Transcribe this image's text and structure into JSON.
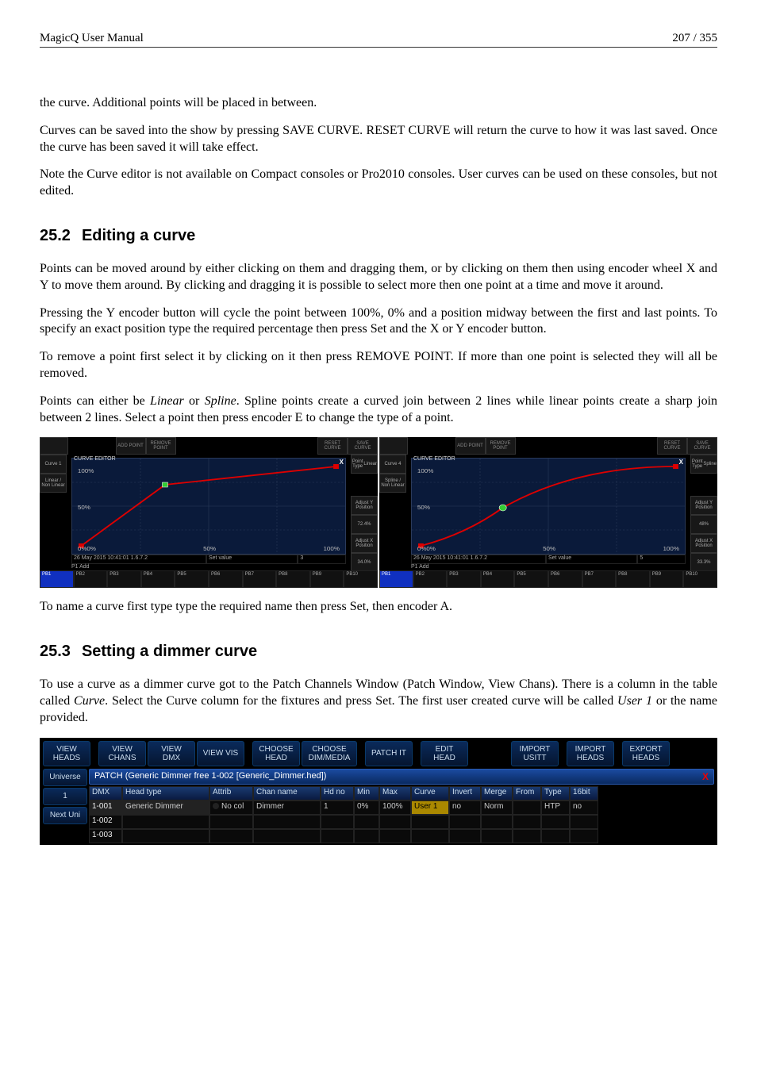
{
  "header": {
    "left": "MagicQ User Manual",
    "right": "207 / 355"
  },
  "intro": {
    "p1": "the curve. Additional points will be placed in between.",
    "p2": "Curves can be saved into the show by pressing SAVE CURVE. RESET CURVE will return the curve to how it was last saved. Once the curve has been saved it will take effect.",
    "p3": "Note the Curve editor is not available on Compact consoles or Pro2010 consoles. User curves can be used on these consoles, but not edited."
  },
  "sec252": {
    "num": "25.2",
    "title": "Editing a curve",
    "p1": "Points can be moved around by either clicking on them and dragging them, or by clicking on them then using encoder wheel X and Y to move them around. By clicking and dragging it is possible to select more then one point at a time and move it around.",
    "p2": "Pressing the Y encoder button will cycle the point between 100%, 0% and a position midway between the first and last points. To specify an exact position type the required percentage then press Set and the X or Y encoder button.",
    "p3": "To remove a point first select it by clicking on it then press REMOVE POINT. If more than one point is selected they will all be removed.",
    "p4a": "Points can either be ",
    "p4b": "Linear",
    "p4c": " or ",
    "p4d": "Spline",
    "p4e": ". Spline points create a curved join between 2 lines while linear points create a sharp join between 2 lines. Select a point then press encoder E to change the type of a point.",
    "after": "To name a curve first type type the required name then press Set, then encoder A."
  },
  "curve_fig": {
    "topbar": {
      "add": "ADD POINT",
      "remove": "REMOVE POINT",
      "reset": "RESET CURVE",
      "save": "SAVE CURVE"
    },
    "plot_title": "CURVE EDITOR",
    "plot_close": "X",
    "labels": {
      "y100": "100%",
      "y50": "50%",
      "y0": "0%",
      "x0": "0%",
      "x50": "50%",
      "x100": "100%"
    },
    "left": {
      "side_left": [
        "Curve 1",
        "Linear / Non Linear"
      ],
      "side_right": [
        "Point Type",
        "Linear",
        "Adjust Y Position",
        "72.4%",
        "Adjust X Position",
        "34.0%"
      ],
      "status_left": "26 May 2015 10:41:01 1.6.7.2",
      "status_mid": "Set value",
      "status_right": "3"
    },
    "right": {
      "side_left": [
        "Curve 4",
        "Spline / Non Linear"
      ],
      "side_right": [
        "Point Type",
        "Spline",
        "Adjust Y Position",
        "48%",
        "Adjust X Position",
        "33.3%"
      ],
      "status_left": "26 May 2015 10:41:01 1.6.7.2",
      "status_mid": "Set value",
      "status_right": "5"
    },
    "playbacks": [
      "PB1",
      "PB2",
      "PB3",
      "PB4",
      "PB5",
      "PB6",
      "PB7",
      "PB8",
      "PB9",
      "PB10"
    ],
    "pl_label": "P1  Add"
  },
  "sec253": {
    "num": "25.3",
    "title": "Setting a dimmer curve",
    "p1a": "To use a curve as a dimmer curve got to the Patch Channels Window (Patch Window, View Chans). There is a column in the table called ",
    "p1b": "Curve",
    "p1c": ". Select the Curve column for the fixtures and press Set. The first user created curve will be called ",
    "p1d": "User 1",
    "p1e": " or the name provided."
  },
  "patch": {
    "toolbar": [
      "VIEW HEADS",
      "VIEW CHANS",
      "VIEW DMX",
      "VIEW VIS",
      "CHOOSE HEAD",
      "CHOOSE DIM/MEDIA",
      "PATCH IT",
      "EDIT HEAD",
      "",
      "IMPORT USITT",
      "IMPORT HEADS",
      "EXPORT HEADS"
    ],
    "side": [
      "Universe",
      "1",
      "Next Uni"
    ],
    "title": "PATCH (Generic Dimmer  free 1-002 [Generic_Dimmer.hed])",
    "close": "X",
    "headers": [
      "DMX",
      "Head type",
      "Attrib",
      "Chan name",
      "Hd no",
      "Min",
      "Max",
      "Curve",
      "Invert",
      "Merge",
      "From",
      "Type",
      "16bit"
    ],
    "row1": {
      "dmx": "1-001",
      "headtype": "Generic Dimmer",
      "attrib": "No col",
      "chan": "Dimmer",
      "hdno": "1",
      "min": "0%",
      "max": "100%",
      "curve": "User 1",
      "invert": "no",
      "merge": "Norm",
      "from": "",
      "type": "HTP",
      "bit16": "no"
    },
    "row2": {
      "dmx": "1-002"
    },
    "row3": {
      "dmx": "1-003"
    }
  }
}
